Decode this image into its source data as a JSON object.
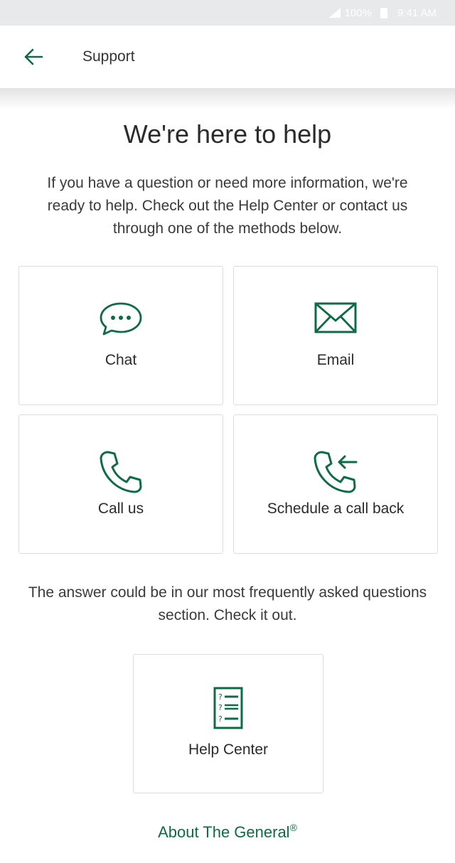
{
  "status_bar": {
    "battery": "100%",
    "time": "9:41 AM"
  },
  "header": {
    "title": "Support",
    "back_icon": "arrow-left-icon"
  },
  "main": {
    "headline": "We're here to help",
    "intro": "If you have a question or need more information, we're ready to help. Check out the Help Center or contact us through one of the methods below.",
    "contact_options": [
      {
        "label": "Chat",
        "icon": "chat-bubble-icon"
      },
      {
        "label": "Email",
        "icon": "envelope-icon"
      },
      {
        "label": "Call us",
        "icon": "phone-icon"
      },
      {
        "label": "Schedule a call back",
        "icon": "phone-callback-icon"
      }
    ],
    "faq_text": "The answer could be in our most frequently asked questions section. Check it out.",
    "help_center": {
      "label": "Help Center",
      "icon": "faq-document-icon"
    },
    "about_link": {
      "label": "About The General",
      "mark": "®"
    }
  },
  "colors": {
    "accent": "#0f6b47",
    "card_border": "#dcdcdc",
    "status_bar_bg": "#e8e9ea"
  }
}
